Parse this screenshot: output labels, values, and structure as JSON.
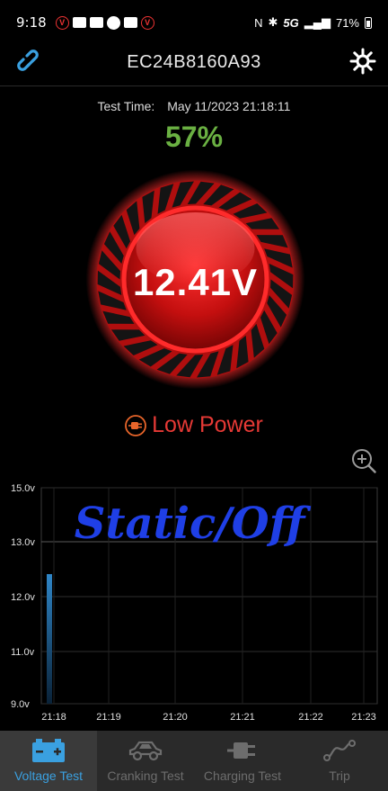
{
  "status_bar": {
    "time": "9:18",
    "network": "5G",
    "battery": "71%"
  },
  "header": {
    "title": "EC24B8160A93",
    "link_icon": "link-icon",
    "settings_icon": "gear-icon"
  },
  "test": {
    "time_label": "Test Time:",
    "time_value": "May 11/2023 21:18:11",
    "percent": "57%",
    "voltage": "12.41V",
    "status": "Low Power",
    "status_icon": "plug-icon"
  },
  "colors": {
    "accent": "#3aa0e0",
    "percent_green": "#6ab042",
    "status_red": "#e53935",
    "overlay_blue": "#1f3fe6"
  },
  "chart_data": {
    "type": "bar",
    "overlay_text": "Static/Off",
    "y_ticks": [
      "15.0v",
      "13.0v",
      "12.0v",
      "11.0v",
      "9.0v"
    ],
    "x_ticks": [
      "21:18",
      "21:19",
      "21:20",
      "21:21",
      "21:22",
      "21:23"
    ],
    "series": [
      {
        "values": [
          12.41
        ]
      }
    ]
  },
  "nav": {
    "items": [
      {
        "label": "Voltage Test",
        "icon": "battery-icon",
        "active": true
      },
      {
        "label": "Cranking Test",
        "icon": "car-icon",
        "active": false
      },
      {
        "label": "Charging Test",
        "icon": "plug-icon",
        "active": false
      },
      {
        "label": "Trip",
        "icon": "route-icon",
        "active": false
      }
    ]
  }
}
